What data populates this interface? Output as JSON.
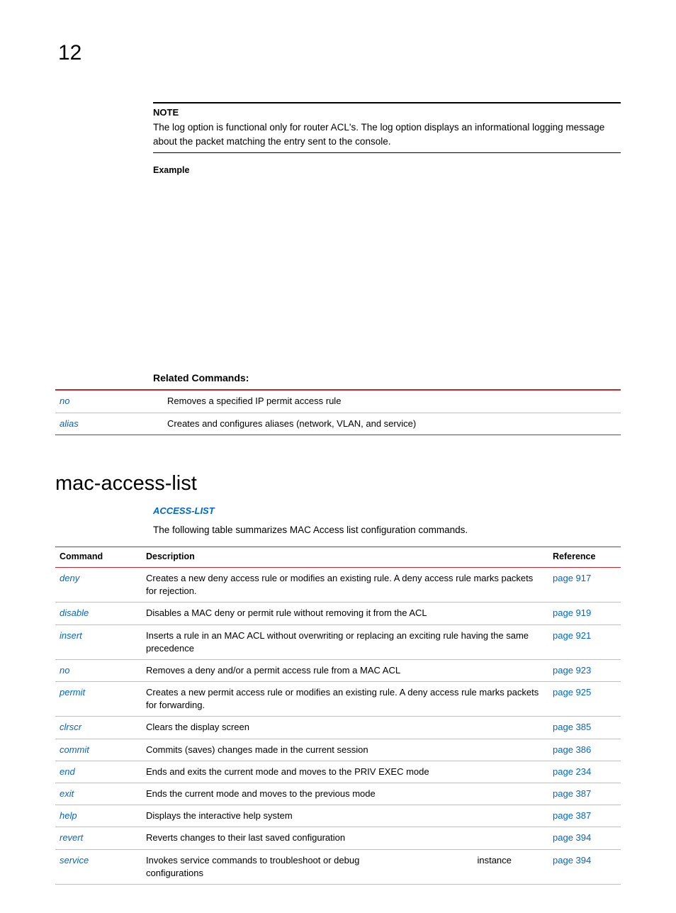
{
  "chapter_number": "12",
  "note": {
    "label": "NOTE",
    "text": "The log option is functional only for router ACL's. The log option displays an informational logging message about the packet matching the entry sent to the console."
  },
  "example_label": "Example",
  "related": {
    "heading": "Related Commands:",
    "rows": [
      {
        "cmd": "no",
        "desc": "Removes a specified IP permit access rule"
      },
      {
        "cmd": "alias",
        "desc": "Creates and configures aliases (network, VLAN, and service)"
      }
    ]
  },
  "section_title": "mac-access-list",
  "access_link": "ACCESS-LIST",
  "intro_text": "The following table summarizes MAC Access list configuration commands.",
  "commands_table": {
    "headers": {
      "cmd": "Command",
      "desc": "Description",
      "ref": "Reference"
    },
    "rows": [
      {
        "cmd": "deny",
        "desc": "Creates a new deny access rule or modifies an existing rule. A deny access rule marks packets for rejection.",
        "ref": "page 917"
      },
      {
        "cmd": "disable",
        "desc": "Disables a MAC deny or permit rule without removing it from the ACL",
        "ref": "page 919"
      },
      {
        "cmd": "insert",
        "desc": "Inserts a rule in an MAC ACL without overwriting or replacing an exciting rule having the same precedence",
        "ref": "page 921"
      },
      {
        "cmd": "no",
        "desc": "Removes a deny and/or a permit access rule from a MAC ACL",
        "ref": "page 923"
      },
      {
        "cmd": "permit",
        "desc": "Creates a new permit access rule or modifies an existing rule. A deny access rule marks packets for forwarding.",
        "ref": "page 925"
      },
      {
        "cmd": "clrscr",
        "desc": "Clears the display screen",
        "ref": "page 385"
      },
      {
        "cmd": "commit",
        "desc": "Commits (saves) changes made in the current session",
        "ref": "page 386"
      },
      {
        "cmd": "end",
        "desc": "Ends and exits the current mode and moves to the PRIV EXEC mode",
        "ref": "page 234"
      },
      {
        "cmd": "exit",
        "desc": "Ends the current mode and moves to the previous mode",
        "ref": "page 387"
      },
      {
        "cmd": "help",
        "desc": "Displays the interactive help system",
        "ref": "page 387"
      },
      {
        "cmd": "revert",
        "desc": "Reverts changes to their last saved configuration",
        "ref": "page 394"
      },
      {
        "cmd": "service",
        "desc": "Invokes service commands to troubleshoot or debug                                              instance configurations",
        "ref": "page 394"
      }
    ]
  }
}
